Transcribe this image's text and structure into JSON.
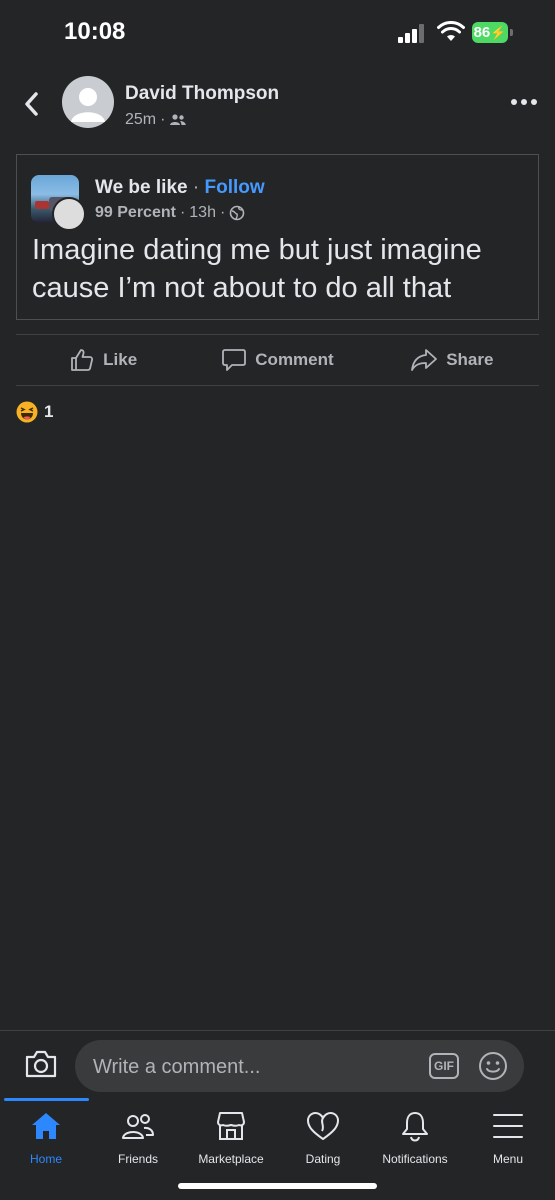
{
  "status": {
    "time": "10:08",
    "battery": "86"
  },
  "post": {
    "author": "David Thompson",
    "time": "25m",
    "separator": "·"
  },
  "shared": {
    "page_name": "We be like",
    "dot": " · ",
    "follow_label": "Follow",
    "sub_page": "99 Percent",
    "time": "13h",
    "separator": "·",
    "text": "Imagine dating me but just imagine cause I’m not about to do all that"
  },
  "actions": {
    "like": "Like",
    "comment": "Comment",
    "share": "Share"
  },
  "reactions": {
    "count": "1"
  },
  "comment_bar": {
    "placeholder": "Write a comment...",
    "gif_label": "GIF"
  },
  "tabs": [
    {
      "label": "Home"
    },
    {
      "label": "Friends"
    },
    {
      "label": "Marketplace"
    },
    {
      "label": "Dating"
    },
    {
      "label": "Notifications"
    },
    {
      "label": "Menu"
    }
  ],
  "colors": {
    "accent": "#2d88ff",
    "follow": "#4599ff",
    "background": "#242526",
    "battery": "#4cd964"
  }
}
